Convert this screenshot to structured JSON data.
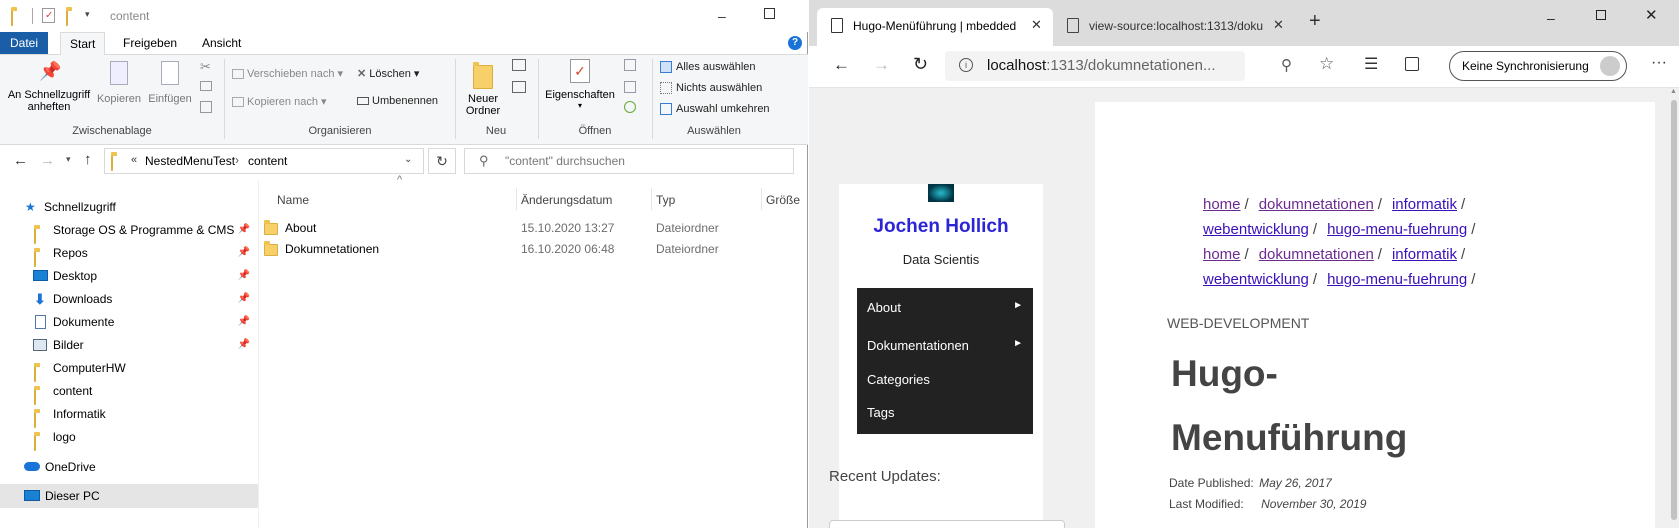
{
  "explorer": {
    "title": "content",
    "ribbon_tabs": [
      "Datei",
      "Start",
      "Freigeben",
      "Ansicht"
    ],
    "groups": {
      "clipboard": {
        "label": "Zwischenablage",
        "pin_label": "An Schnellzugriff anheften",
        "copy_label": "Kopieren",
        "paste_label": "Einfügen"
      },
      "organize": {
        "label": "Organisieren",
        "move_label": "Verschieben nach",
        "copy_to_label": "Kopieren nach",
        "delete_label": "Löschen",
        "rename_label": "Umbenennen"
      },
      "new": {
        "label": "Neu",
        "new_folder_label": "Neuer Ordner"
      },
      "open": {
        "label": "Öffnen",
        "properties_label": "Eigenschaften"
      },
      "select": {
        "label": "Auswählen",
        "select_all": "Alles auswählen",
        "select_none": "Nichts auswählen",
        "invert": "Auswahl umkehren"
      }
    },
    "address": {
      "crumb_parent": "NestedMenuTest",
      "crumb_current": "content",
      "search_placeholder": "\"content\" durchsuchen"
    },
    "nav_pane": {
      "quick_access": "Schnellzugriff",
      "items": [
        "Storage OS & Programme & CMS",
        "Repos",
        "Desktop",
        "Downloads",
        "Dokumente",
        "Bilder",
        "ComputerHW",
        "content",
        "Informatik",
        "logo"
      ],
      "onedrive": "OneDrive",
      "this_pc": "Dieser PC"
    },
    "columns": {
      "name": "Name",
      "date": "Änderungsdatum",
      "type": "Typ",
      "size": "Größe"
    },
    "files": [
      {
        "name": "About",
        "date": "15.10.2020 13:27",
        "type": "Dateiordner"
      },
      {
        "name": "Dokumnetationen",
        "date": "16.10.2020 06:48",
        "type": "Dateiordner"
      }
    ]
  },
  "browser": {
    "tabs": [
      {
        "title": "Hugo-Menüführung | mbedded"
      },
      {
        "title": "view-source:localhost:1313/doku"
      }
    ],
    "url_host": "localhost",
    "url_path": ":1313/dokumnetationen...",
    "sync_label": "Keine Synchronisierung",
    "site": {
      "author": "Jochen Hollich",
      "subtitle": "Data Scientis",
      "menu": [
        {
          "label": "About",
          "arrow": "►"
        },
        {
          "label": "Dokumentationen",
          "arrow": "►"
        },
        {
          "label": "Categories",
          "arrow": ""
        },
        {
          "label": "Tags",
          "arrow": ""
        }
      ],
      "recent_updates": "Recent Updates:"
    },
    "article": {
      "breadcrumb_line1": [
        "home",
        "dokumnetationen",
        "informatik"
      ],
      "breadcrumb_line2": [
        "webentwicklung",
        "hugo-menu-fuehrung"
      ],
      "category": "WEB-DEVELOPMENT",
      "title_line1": "Hugo-",
      "title_line2": "Menuführung",
      "date_published_label": "Date Published:",
      "date_published": "May 26, 2017",
      "last_modified_label": "Last Modified:",
      "last_modified": "November 30, 2019"
    }
  }
}
